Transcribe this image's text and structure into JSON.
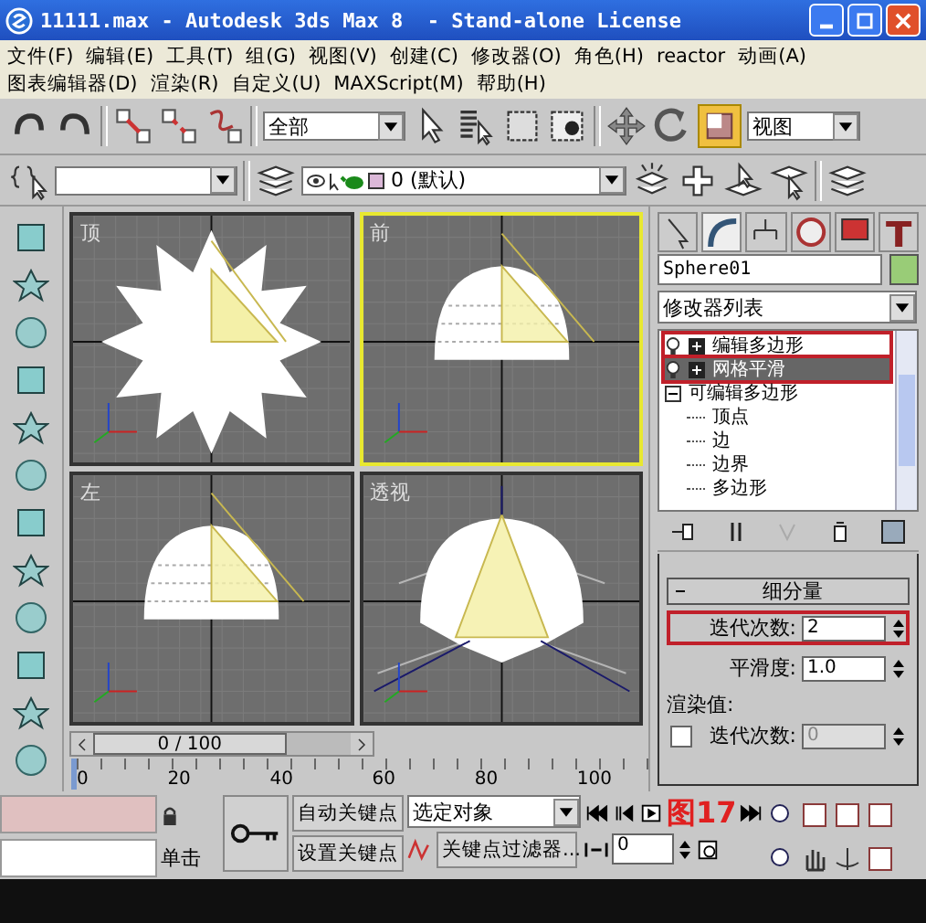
{
  "window": {
    "title": "11111.max - Autodesk 3ds Max 8  - Stand-alone License"
  },
  "menu_rows": [
    [
      "文件(F)",
      "编辑(E)",
      "工具(T)",
      "组(G)",
      "视图(V)",
      "创建(C)",
      "修改器(O)",
      "角色(H)",
      "reactor",
      "动画(A)"
    ],
    [
      "图表编辑器(D)",
      "渲染(R)",
      "自定义(U)",
      "MAXScript(M)",
      "帮助(H)"
    ]
  ],
  "toolbar": {
    "selection_filter": "全部",
    "coordinate_system": "视图",
    "layer": "0 (默认)"
  },
  "viewports": [
    {
      "label": "顶",
      "kind": "top",
      "active": false
    },
    {
      "label": "前",
      "kind": "front",
      "active": true
    },
    {
      "label": "左",
      "kind": "left",
      "active": false
    },
    {
      "label": "透视",
      "kind": "perspective",
      "active": false
    }
  ],
  "command_panel": {
    "object_name": "Sphere01",
    "modifier_list": "修改器列表",
    "stack": [
      {
        "label": "编辑多边形",
        "selected": false,
        "highlighted": true
      },
      {
        "label": "网格平滑",
        "selected": true,
        "highlighted": true
      },
      {
        "label": "可编辑多边形",
        "selected": false,
        "highlighted": false,
        "expanded": true,
        "children": [
          {
            "label": "顶点"
          },
          {
            "label": "边"
          },
          {
            "label": "边界"
          },
          {
            "label": "多边形"
          }
        ]
      }
    ],
    "rollout": {
      "title": "细分量",
      "fields": [
        {
          "label": "迭代次数:",
          "value": "2",
          "disabled": false,
          "highlighted": true
        },
        {
          "label": "平滑度:",
          "value": "1.0",
          "disabled": false,
          "highlighted": false
        }
      ],
      "render_values": {
        "label": "渲染值:",
        "checked": false,
        "field": {
          "label": "迭代次数:",
          "value": "0",
          "disabled": true
        }
      }
    }
  },
  "time_slider": {
    "position": "0 / 100",
    "ticks": [
      "0",
      "20",
      "40",
      "60",
      "80",
      "100"
    ]
  },
  "animation": {
    "prompt": "单击",
    "auto_key": "自动关键点",
    "set_key": "设置关键点",
    "key_mode": "选定对象",
    "key_filters": "关键点过滤器...",
    "frame": "0"
  },
  "annotation": "图17"
}
